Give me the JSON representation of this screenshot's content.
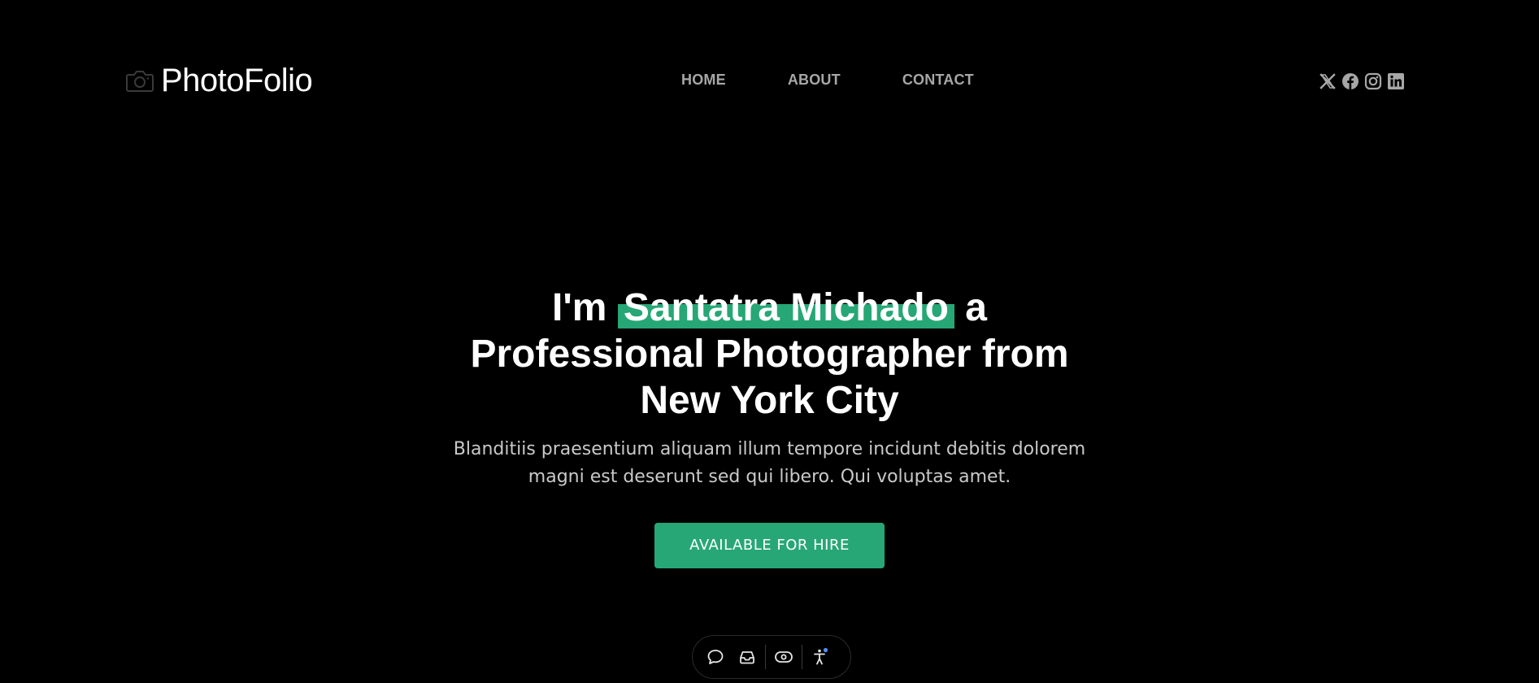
{
  "header": {
    "brand": "PhotoFolio",
    "nav": {
      "home": "HOME",
      "about": "ABOUT",
      "contact": "CONTACT"
    },
    "social_icons": [
      "x-icon",
      "facebook-icon",
      "instagram-icon",
      "linkedin-icon"
    ]
  },
  "hero": {
    "title_prefix": "I'm",
    "title_name": "Santatra Michado",
    "title_suffix": "a Professional Photographer from New York City",
    "subtitle": "Blanditiis praesentium aliquam illum tempore incidunt debitis dolorem magni est deserunt sed qui libero. Qui voluptas amet.",
    "cta_label": "AVAILABLE FOR HIRE"
  },
  "toolbar": {
    "icons": [
      "chat-icon",
      "inbox-icon",
      "eye-icon",
      "accessibility-icon"
    ]
  },
  "colors": {
    "background": "#000000",
    "accent": "#27a776",
    "nav_text": "#a7a7a7",
    "subtitle_text": "#c9c9c9"
  }
}
